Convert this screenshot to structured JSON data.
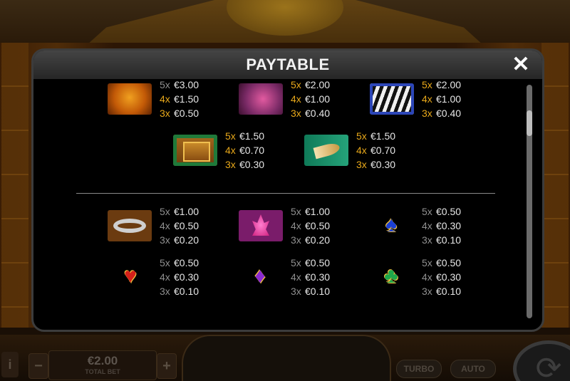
{
  "modal": {
    "title": "PAYTABLE",
    "close_label": "✕"
  },
  "colors": {
    "multiplier_highlight": "#e8a81a",
    "multiplier_normal": "#8f8f8f",
    "amount": "#e6e6e6"
  },
  "symbols": {
    "lion": {
      "icon": "lion-icon",
      "pays": [
        [
          "5x",
          "€3.00"
        ],
        [
          "4x",
          "€1.50"
        ],
        [
          "3x",
          "€0.50"
        ]
      ]
    },
    "flamingo": {
      "icon": "flamingo-icon",
      "pays": [
        [
          "5x",
          "€2.00"
        ],
        [
          "4x",
          "€1.00"
        ],
        [
          "3x",
          "€0.40"
        ]
      ]
    },
    "zebra": {
      "icon": "zebra-icon",
      "pays": [
        [
          "5x",
          "€2.00"
        ],
        [
          "4x",
          "€1.00"
        ],
        [
          "3x",
          "€0.40"
        ]
      ]
    },
    "chest": {
      "icon": "treasure-chest-icon",
      "pays": [
        [
          "5x",
          "€1.50"
        ],
        [
          "4x",
          "€0.70"
        ],
        [
          "3x",
          "€0.30"
        ]
      ]
    },
    "horn": {
      "icon": "horn-icon",
      "pays": [
        [
          "5x",
          "€1.50"
        ],
        [
          "4x",
          "€0.70"
        ],
        [
          "3x",
          "€0.30"
        ]
      ]
    },
    "bracelet": {
      "icon": "bracelet-icon",
      "pays": [
        [
          "5x",
          "€1.00"
        ],
        [
          "4x",
          "€0.50"
        ],
        [
          "3x",
          "€0.20"
        ]
      ]
    },
    "lotus": {
      "icon": "lotus-icon",
      "pays": [
        [
          "5x",
          "€1.00"
        ],
        [
          "4x",
          "€0.50"
        ],
        [
          "3x",
          "€0.20"
        ]
      ]
    },
    "spade": {
      "icon": "spade-icon",
      "pays": [
        [
          "5x",
          "€0.50"
        ],
        [
          "4x",
          "€0.30"
        ],
        [
          "3x",
          "€0.10"
        ]
      ]
    },
    "heart": {
      "icon": "heart-icon",
      "pays": [
        [
          "5x",
          "€0.50"
        ],
        [
          "4x",
          "€0.30"
        ],
        [
          "3x",
          "€0.10"
        ]
      ]
    },
    "diamond": {
      "icon": "diamond-icon",
      "pays": [
        [
          "5x",
          "€0.50"
        ],
        [
          "4x",
          "€0.30"
        ],
        [
          "3x",
          "€0.10"
        ]
      ]
    },
    "club": {
      "icon": "club-icon",
      "pays": [
        [
          "5x",
          "€0.50"
        ],
        [
          "4x",
          "€0.30"
        ],
        [
          "3x",
          "€0.10"
        ]
      ]
    }
  },
  "bottom_bar": {
    "bet_value": "€2.00",
    "bet_label": "TOTAL BET",
    "minus_label": "−",
    "plus_label": "+",
    "info_label": "i",
    "turbo_label": "TURBO",
    "auto_label": "AUTO"
  }
}
